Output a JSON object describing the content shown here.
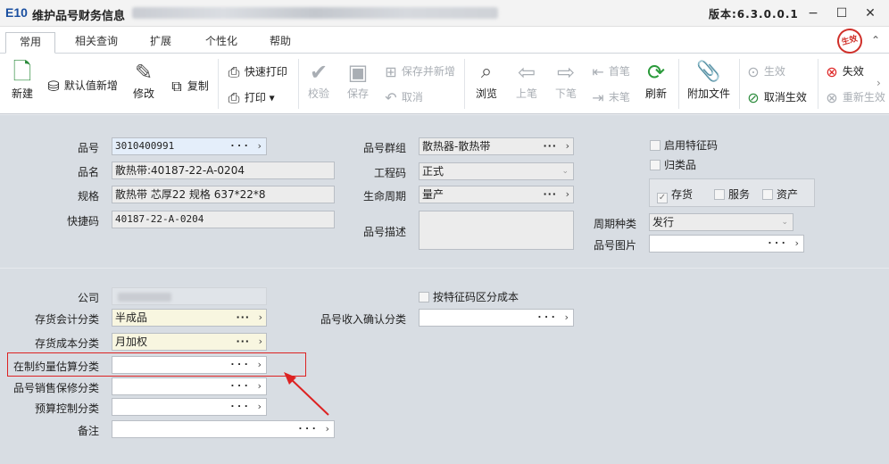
{
  "app": {
    "logo": "E10",
    "title": "维护品号财务信息",
    "version": "版本:6.3.0.0.1"
  },
  "window_buttons": {
    "minimize": "−",
    "maximize": "☐",
    "close": "✕"
  },
  "tabs": [
    "常用",
    "相关查询",
    "扩展",
    "个性化",
    "帮助"
  ],
  "stamp": "生效",
  "toolbar": {
    "new": "新建",
    "default_new": "默认值新增",
    "modify": "修改",
    "copy": "复制",
    "quick_print": "快速打印",
    "print": "打印",
    "validate": "校验",
    "save": "保存",
    "save_new": "保存并新增",
    "cancel": "取消",
    "browse": "浏览",
    "prev": "上笔",
    "next": "下笔",
    "first": "首笔",
    "last": "末笔",
    "refresh": "刷新",
    "attach": "附加文件",
    "effective": "生效",
    "cancel_effective": "取消生效",
    "invalid": "失效",
    "re_effective": "重新生效"
  },
  "form": {
    "item_no": {
      "label": "品号",
      "value": "3010400991"
    },
    "item_name": {
      "label": "品名",
      "value": "散热带:40187-22-A-0204"
    },
    "spec": {
      "label": "规格",
      "value": "散热带 芯厚22 规格 637*22*8"
    },
    "quick_code": {
      "label": "快捷码",
      "value": "40187-22-A-0204"
    },
    "item_group": {
      "label": "品号群组",
      "value": "散热器-散热带"
    },
    "engineering_code": {
      "label": "工程码",
      "value": "正式"
    },
    "lifecycle": {
      "label": "生命周期",
      "value": "量产"
    },
    "item_desc": {
      "label": "品号描述",
      "value": ""
    },
    "enable_feature_code": {
      "label": "启用特征码"
    },
    "classified": {
      "label": "归类品"
    },
    "inventory": {
      "label": "存货",
      "checked": true
    },
    "service": {
      "label": "服务"
    },
    "asset": {
      "label": "资产"
    },
    "cycle_type": {
      "label": "周期种类",
      "value": "发行"
    },
    "item_image": {
      "label": "品号图片",
      "value": ""
    },
    "company": {
      "label": "公司"
    },
    "cost_by_feature": {
      "label": "按特征码区分成本"
    },
    "inv_accounting": {
      "label": "存货会计分类",
      "value": "半成品"
    },
    "revenue_recog": {
      "label": "品号收入确认分类",
      "value": ""
    },
    "inv_cost": {
      "label": "存货成本分类",
      "value": "月加权"
    },
    "wip_estimate": {
      "label": "在制约量估算分类",
      "value": ""
    },
    "sales_warranty": {
      "label": "品号销售保修分类",
      "value": ""
    },
    "budget_control": {
      "label": "预算控制分类",
      "value": ""
    },
    "remark": {
      "label": "备注",
      "value": ""
    }
  },
  "colors": {
    "highlight": "#dd2222",
    "accent": "#1a4fa0",
    "stamp": "#d0302a"
  }
}
